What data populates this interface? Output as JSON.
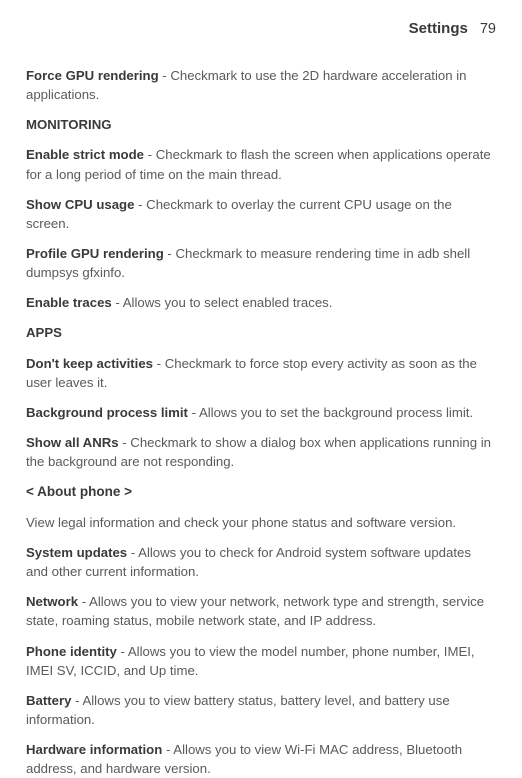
{
  "header": {
    "title": "Settings",
    "page": "79"
  },
  "entries": [
    {
      "term": "Force GPU rendering",
      "desc": " - Checkmark to use the 2D hardware acceleration in applications."
    }
  ],
  "monitoring": {
    "label": "MONITORING",
    "items": [
      {
        "term": "Enable strict mode",
        "desc": " - Checkmark to flash the screen when applications operate for a long period of time on the main thread."
      },
      {
        "term": "Show CPU usage",
        "desc": " - Checkmark to overlay the current CPU usage on the screen."
      },
      {
        "term": "Profile GPU rendering",
        "desc": " - Checkmark to measure rendering time in adb shell dumpsys gfxinfo."
      },
      {
        "term": "Enable traces",
        "desc": " - Allows you to select enabled traces."
      }
    ]
  },
  "apps": {
    "label": "APPS",
    "items": [
      {
        "term": "Don't keep activities",
        "desc": " - Checkmark to force stop every activity as soon as the user leaves it."
      },
      {
        "term": "Background process limit",
        "desc": " - Allows you to set the background process limit."
      },
      {
        "term": "Show all ANRs",
        "desc": " - Checkmark to show a dialog box when applications running in the background are not responding."
      }
    ]
  },
  "about": {
    "heading": "< About phone >",
    "intro": "View legal information and check your phone status and software version.",
    "items": [
      {
        "term": "System updates",
        "desc": " - Allows you to check for Android system software updates and other current information."
      },
      {
        "term": "Network",
        "desc": " - Allows you to view your network, network type and strength, service state, roaming status, mobile network state, and IP address."
      },
      {
        "term": "Phone identity",
        "desc": " - Allows you to view the model number, phone number, IMEI, IMEI SV, ICCID, and Up time."
      },
      {
        "term": "Battery",
        "desc": " - Allows you to view battery status, battery level, and battery use information."
      },
      {
        "term": "Hardware information",
        "desc": " - Allows you to view Wi-Fi MAC address, Bluetooth address, and hardware version."
      }
    ]
  }
}
